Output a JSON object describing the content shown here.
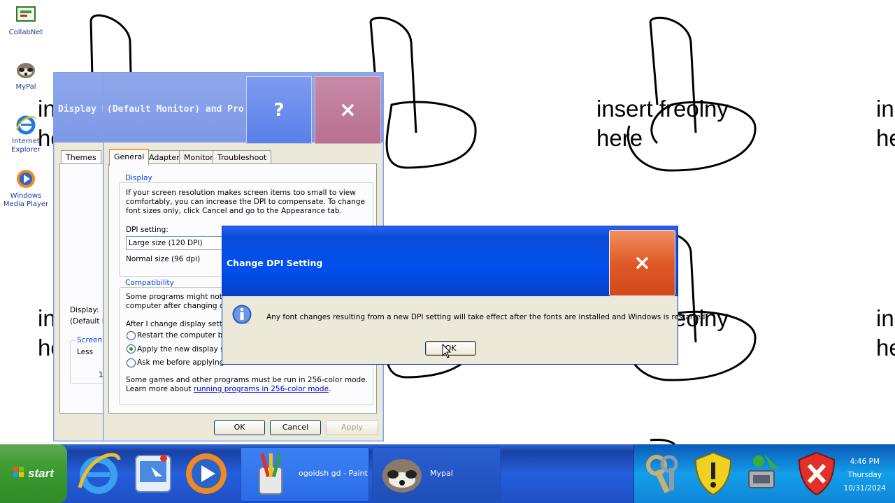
{
  "wallpaper": {
    "line1": "insert freolny",
    "line2": "here",
    "edge1": "in",
    "edge2": "he"
  },
  "desktop_icons": [
    {
      "label": "CollabNet",
      "icon": "collabnet-icon"
    },
    {
      "label": "MyPal",
      "icon": "mypal-icon"
    },
    {
      "label": "Internet Explorer",
      "icon": "internet-explorer-icon"
    },
    {
      "label": "Windows Media Player",
      "icon": "media-player-icon"
    }
  ],
  "back_window": {
    "title": "Display Pr",
    "tab": "Themes",
    "display_label": "Display:",
    "display_value": "(Default M",
    "screen_group": "Screen",
    "less": "Less",
    "partial": "1"
  },
  "props_window": {
    "title": "(Default Monitor) and  Pro...",
    "help": "?",
    "close": "×",
    "tabs": [
      "General",
      "Adapter",
      "Monitor",
      "Troubleshoot"
    ],
    "display_group": "Display",
    "display_text": [
      "If your screen resolution makes screen items too small to view",
      "comfortably, you can increase the DPI to compensate.  To change",
      "font sizes only, click Cancel and go to the Appearance tab."
    ],
    "dpi_label": "DPI setting:",
    "dpi_value": "Large size (120 DPI)",
    "dpi_normal": "Normal size (96 dpi)",
    "compat_group": "Compatibility",
    "compat_text": [
      "Some programs might not op",
      "computer after changing disp"
    ],
    "after_label": "After I change display settin",
    "radios": [
      {
        "label": "Restart the computer bef",
        "selected": false
      },
      {
        "label": "Apply the new display set",
        "selected": true
      },
      {
        "label": "Ask me before applying th",
        "selected": false
      }
    ],
    "games_text": "Some games and other programs must be run in 256-color mode.",
    "learn_prefix": "Learn more about ",
    "learn_link": "running programs in 256-color mode",
    "learn_suffix": ".",
    "ok": "OK",
    "cancel": "Cancel",
    "apply": "Apply"
  },
  "dialog": {
    "title": "Change DPI Setting",
    "close": "×",
    "message": "Any font changes resulting from a new DPI setting will take effect after the fonts are installed and Windows is restarted.",
    "ok": "OK"
  },
  "taskbar": {
    "start": "start",
    "quick_launch": [
      "internet-explorer-icon",
      "show-desktop-icon",
      "media-player-icon"
    ],
    "tasks": [
      {
        "label": "ogoidsh gd - Paint",
        "icon": "paint-icon"
      },
      {
        "label": "Mypal",
        "icon": "mypal-icon"
      }
    ],
    "tray_icons": [
      "keys-icon",
      "security-shield-icon",
      "network-icon",
      "security-alert-icon"
    ],
    "time": "4:46 PM",
    "day": "Thursday",
    "date": "10/31/2024"
  }
}
